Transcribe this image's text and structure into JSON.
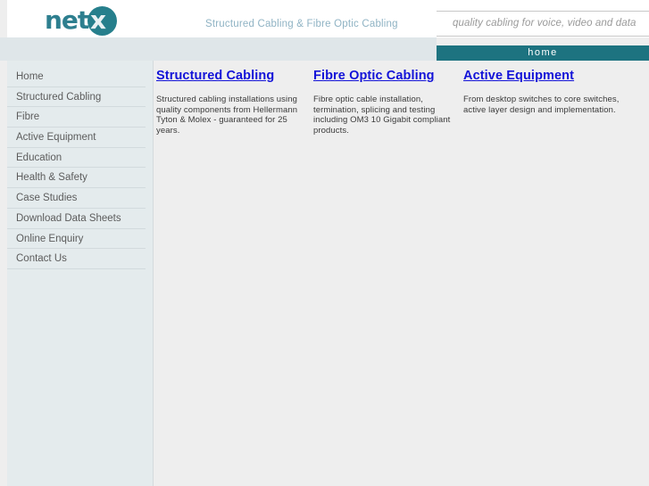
{
  "header": {
    "logo": {
      "text_main": "net",
      "text_accent": "x",
      "accent_color": "#267f8c"
    },
    "tagline": "Structured Cabling & Fibre Optic Cabling",
    "slogan_box": {
      "value": "quality cabling for voice, video and data",
      "placeholder": "quality cabling for voice, video and data"
    }
  },
  "nav": {
    "items": [
      {
        "label": "home",
        "active": true
      }
    ],
    "bar_color": "#1d7380"
  },
  "sidebar": {
    "items": [
      {
        "label": "Home"
      },
      {
        "label": "Structured Cabling"
      },
      {
        "label": "Fibre"
      },
      {
        "label": "Active Equipment"
      },
      {
        "label": "Education"
      },
      {
        "label": "Health & Safety"
      },
      {
        "label": "Case Studies"
      },
      {
        "label": "Download Data Sheets"
      },
      {
        "label": "Online Enquiry"
      },
      {
        "label": "Contact Us"
      }
    ]
  },
  "main": {
    "columns": [
      {
        "title": "Structured Cabling",
        "body": "Structured cabling installations using quality components from Hellermann Tyton & Molex - guaranteed for 25 years."
      },
      {
        "title": "Fibre Optic Cabling",
        "body": "Fibre optic cable installation, termination, splicing and testing including OM3 10 Gigabit compliant products."
      },
      {
        "title": "Active Equipment",
        "body": "From desktop switches to core switches, active layer design and implementation."
      }
    ],
    "link_color": "#1313d8"
  }
}
